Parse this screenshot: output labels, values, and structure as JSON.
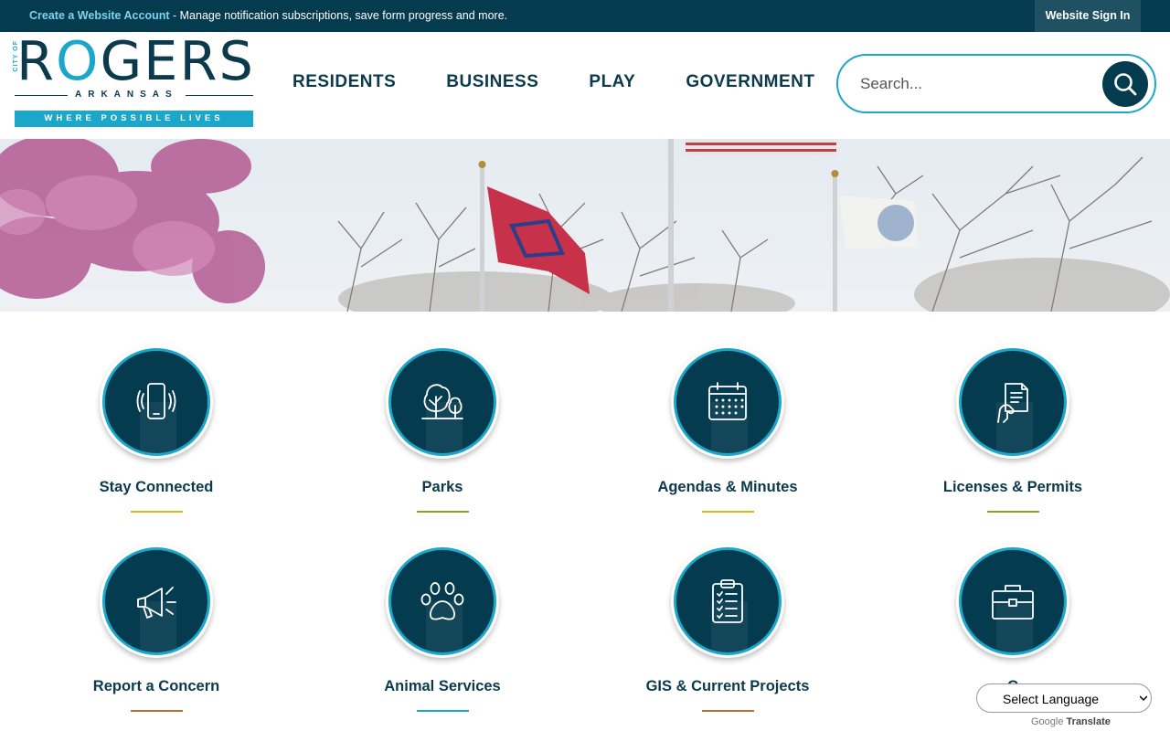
{
  "topbar": {
    "create_link": "Create a Website Account",
    "message": " - Manage notification subscriptions, save form progress and more.",
    "signin": "Website Sign In"
  },
  "logo": {
    "city_of": "CITY OF",
    "name_r": "R",
    "name_o": "O",
    "name_rest": "GERS",
    "state": "ARKANSAS",
    "tagline": "WHERE POSSIBLE LIVES"
  },
  "nav": {
    "items": [
      "RESIDENTS",
      "BUSINESS",
      "PLAY",
      "GOVERNMENT"
    ]
  },
  "search": {
    "placeholder": "Search..."
  },
  "tiles": [
    {
      "label": "Stay Connected",
      "icon": "smartphone-icon",
      "bar_color": "#e3b51b"
    },
    {
      "label": "Parks",
      "icon": "trees-icon",
      "bar_color": "#8ca31b"
    },
    {
      "label": "Agendas & Minutes",
      "icon": "calendar-icon",
      "bar_color": "#e3b51b"
    },
    {
      "label": "Licenses & Permits",
      "icon": "document-hand-icon",
      "bar_color": "#8ca31b"
    },
    {
      "label": "Report a Concern",
      "icon": "megaphone-icon",
      "bar_color": "#b86e2c"
    },
    {
      "label": "Animal Services",
      "icon": "paw-icon",
      "bar_color": "#1aa7c9"
    },
    {
      "label": "GIS & Current Projects",
      "icon": "clipboard-checklist-icon",
      "bar_color": "#b86e2c"
    },
    {
      "label": "C",
      "icon": "briefcase-icon",
      "bar_color": "#1aa7c9"
    }
  ],
  "translate": {
    "select_label": "Select Language",
    "powered_google": "Google",
    "powered_translate": "Translate"
  },
  "colors": {
    "navy": "#053b4e",
    "teal": "#1aa7c9"
  }
}
